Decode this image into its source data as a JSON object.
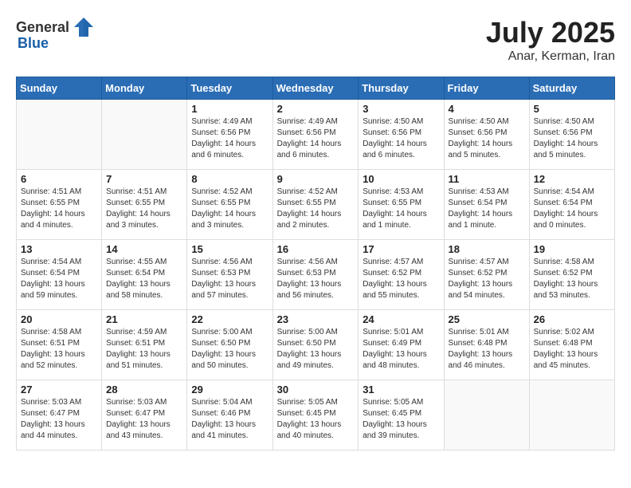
{
  "header": {
    "logo_general": "General",
    "logo_blue": "Blue",
    "month_year": "July 2025",
    "location": "Anar, Kerman, Iran"
  },
  "days_of_week": [
    "Sunday",
    "Monday",
    "Tuesday",
    "Wednesday",
    "Thursday",
    "Friday",
    "Saturday"
  ],
  "weeks": [
    [
      {
        "day": "",
        "info": ""
      },
      {
        "day": "",
        "info": ""
      },
      {
        "day": "1",
        "info": "Sunrise: 4:49 AM\nSunset: 6:56 PM\nDaylight: 14 hours and 6 minutes."
      },
      {
        "day": "2",
        "info": "Sunrise: 4:49 AM\nSunset: 6:56 PM\nDaylight: 14 hours and 6 minutes."
      },
      {
        "day": "3",
        "info": "Sunrise: 4:50 AM\nSunset: 6:56 PM\nDaylight: 14 hours and 6 minutes."
      },
      {
        "day": "4",
        "info": "Sunrise: 4:50 AM\nSunset: 6:56 PM\nDaylight: 14 hours and 5 minutes."
      },
      {
        "day": "5",
        "info": "Sunrise: 4:50 AM\nSunset: 6:56 PM\nDaylight: 14 hours and 5 minutes."
      }
    ],
    [
      {
        "day": "6",
        "info": "Sunrise: 4:51 AM\nSunset: 6:55 PM\nDaylight: 14 hours and 4 minutes."
      },
      {
        "day": "7",
        "info": "Sunrise: 4:51 AM\nSunset: 6:55 PM\nDaylight: 14 hours and 3 minutes."
      },
      {
        "day": "8",
        "info": "Sunrise: 4:52 AM\nSunset: 6:55 PM\nDaylight: 14 hours and 3 minutes."
      },
      {
        "day": "9",
        "info": "Sunrise: 4:52 AM\nSunset: 6:55 PM\nDaylight: 14 hours and 2 minutes."
      },
      {
        "day": "10",
        "info": "Sunrise: 4:53 AM\nSunset: 6:55 PM\nDaylight: 14 hours and 1 minute."
      },
      {
        "day": "11",
        "info": "Sunrise: 4:53 AM\nSunset: 6:54 PM\nDaylight: 14 hours and 1 minute."
      },
      {
        "day": "12",
        "info": "Sunrise: 4:54 AM\nSunset: 6:54 PM\nDaylight: 14 hours and 0 minutes."
      }
    ],
    [
      {
        "day": "13",
        "info": "Sunrise: 4:54 AM\nSunset: 6:54 PM\nDaylight: 13 hours and 59 minutes."
      },
      {
        "day": "14",
        "info": "Sunrise: 4:55 AM\nSunset: 6:54 PM\nDaylight: 13 hours and 58 minutes."
      },
      {
        "day": "15",
        "info": "Sunrise: 4:56 AM\nSunset: 6:53 PM\nDaylight: 13 hours and 57 minutes."
      },
      {
        "day": "16",
        "info": "Sunrise: 4:56 AM\nSunset: 6:53 PM\nDaylight: 13 hours and 56 minutes."
      },
      {
        "day": "17",
        "info": "Sunrise: 4:57 AM\nSunset: 6:52 PM\nDaylight: 13 hours and 55 minutes."
      },
      {
        "day": "18",
        "info": "Sunrise: 4:57 AM\nSunset: 6:52 PM\nDaylight: 13 hours and 54 minutes."
      },
      {
        "day": "19",
        "info": "Sunrise: 4:58 AM\nSunset: 6:52 PM\nDaylight: 13 hours and 53 minutes."
      }
    ],
    [
      {
        "day": "20",
        "info": "Sunrise: 4:58 AM\nSunset: 6:51 PM\nDaylight: 13 hours and 52 minutes."
      },
      {
        "day": "21",
        "info": "Sunrise: 4:59 AM\nSunset: 6:51 PM\nDaylight: 13 hours and 51 minutes."
      },
      {
        "day": "22",
        "info": "Sunrise: 5:00 AM\nSunset: 6:50 PM\nDaylight: 13 hours and 50 minutes."
      },
      {
        "day": "23",
        "info": "Sunrise: 5:00 AM\nSunset: 6:50 PM\nDaylight: 13 hours and 49 minutes."
      },
      {
        "day": "24",
        "info": "Sunrise: 5:01 AM\nSunset: 6:49 PM\nDaylight: 13 hours and 48 minutes."
      },
      {
        "day": "25",
        "info": "Sunrise: 5:01 AM\nSunset: 6:48 PM\nDaylight: 13 hours and 46 minutes."
      },
      {
        "day": "26",
        "info": "Sunrise: 5:02 AM\nSunset: 6:48 PM\nDaylight: 13 hours and 45 minutes."
      }
    ],
    [
      {
        "day": "27",
        "info": "Sunrise: 5:03 AM\nSunset: 6:47 PM\nDaylight: 13 hours and 44 minutes."
      },
      {
        "day": "28",
        "info": "Sunrise: 5:03 AM\nSunset: 6:47 PM\nDaylight: 13 hours and 43 minutes."
      },
      {
        "day": "29",
        "info": "Sunrise: 5:04 AM\nSunset: 6:46 PM\nDaylight: 13 hours and 41 minutes."
      },
      {
        "day": "30",
        "info": "Sunrise: 5:05 AM\nSunset: 6:45 PM\nDaylight: 13 hours and 40 minutes."
      },
      {
        "day": "31",
        "info": "Sunrise: 5:05 AM\nSunset: 6:45 PM\nDaylight: 13 hours and 39 minutes."
      },
      {
        "day": "",
        "info": ""
      },
      {
        "day": "",
        "info": ""
      }
    ]
  ]
}
